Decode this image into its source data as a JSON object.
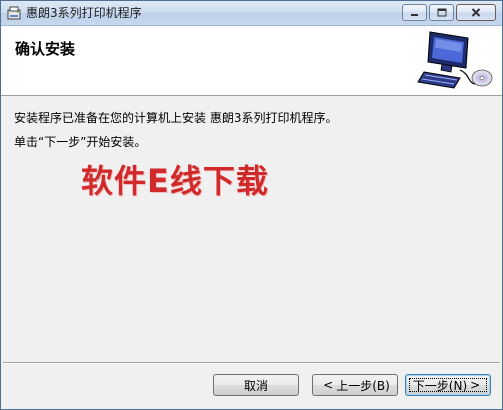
{
  "window": {
    "title": "惠朗3系列打印机程序"
  },
  "header": {
    "title": "确认安装"
  },
  "body": {
    "line1": "安装程序已准备在您的计算机上安装 惠朗3系列打印机程序。",
    "line2": "单击“下一步”开始安装。"
  },
  "watermark": {
    "text": "软件E线下载",
    "color": "#d12a2a"
  },
  "buttons": {
    "cancel_label": "取消",
    "back_label": "上一步(B)",
    "next_label": "下一步(N)"
  },
  "colors": {
    "accent": "#3c7fb1"
  }
}
